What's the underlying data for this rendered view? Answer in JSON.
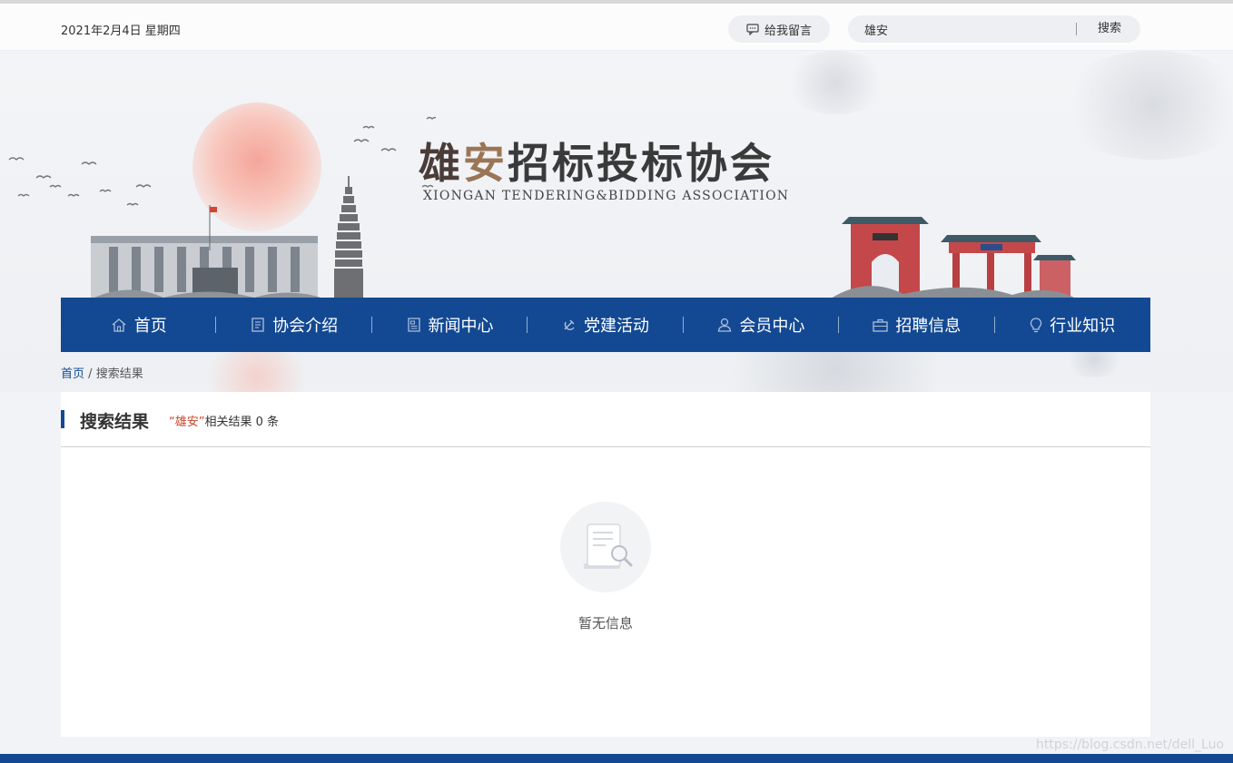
{
  "topbar": {
    "date": "2021年2月4日 星期四",
    "message_label": "给我留言",
    "search_value": "雄安",
    "search_button": "搜索"
  },
  "header": {
    "logo_cn": "雄安招标投标协会",
    "logo_cn_parts": [
      "雄",
      "安",
      "招标投标协会"
    ],
    "logo_en": "XIONGAN TENDERING&BIDDING ASSOCIATION"
  },
  "nav": {
    "items": [
      {
        "label": "首页",
        "icon": "home-icon"
      },
      {
        "label": "协会介绍",
        "icon": "document-icon"
      },
      {
        "label": "新闻中心",
        "icon": "news-icon"
      },
      {
        "label": "党建活动",
        "icon": "party-emblem-icon"
      },
      {
        "label": "会员中心",
        "icon": "user-icon"
      },
      {
        "label": "招聘信息",
        "icon": "briefcase-icon"
      },
      {
        "label": "行业知识",
        "icon": "lightbulb-icon"
      }
    ]
  },
  "breadcrumb": {
    "home": "首页",
    "separator": "/",
    "current": "搜索结果"
  },
  "results": {
    "title": "搜索结果",
    "keyword_quoted": "“雄安”",
    "count_text": "相关结果 0 条",
    "empty_text": "暂无信息"
  },
  "watermark": "https://blog.csdn.net/dell_Luo",
  "colors": {
    "primary": "#134993",
    "keyword": "#c9452b",
    "background": "#f2f3f6"
  }
}
